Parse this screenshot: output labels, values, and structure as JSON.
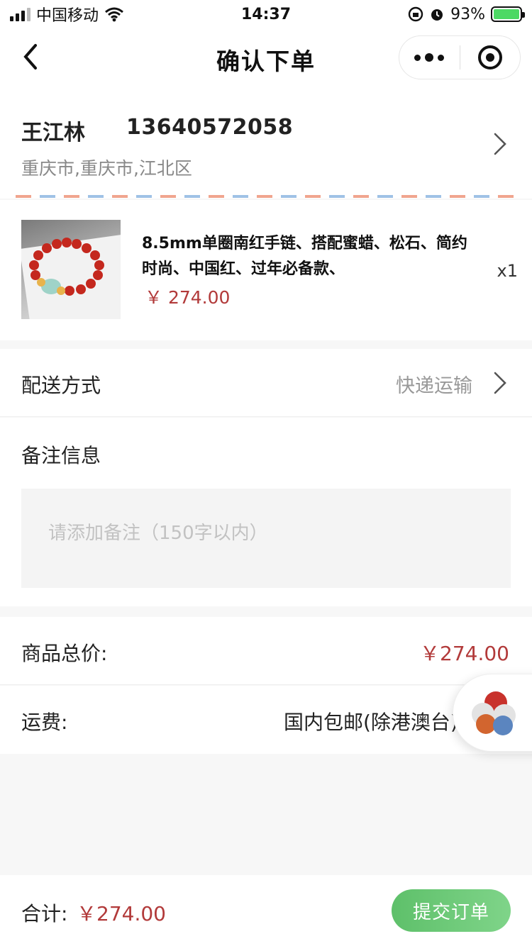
{
  "status_bar": {
    "carrier": "中国移动",
    "time": "14:37",
    "battery": "93%"
  },
  "nav": {
    "title": "确认下单"
  },
  "address": {
    "name": "王江林",
    "phone": "13640572058",
    "region": "重庆市,重庆市,江北区"
  },
  "product": {
    "title": "8.5mm单圈南红手链、搭配蜜蜡、松石、简约时尚、中国红、过年必备款、",
    "price": "￥ 274.00",
    "quantity": "x1"
  },
  "delivery": {
    "label": "配送方式",
    "value": "快递运输"
  },
  "remarks": {
    "label": "备注信息",
    "placeholder": "请添加备注（150字以内）"
  },
  "totals": {
    "goods_label": "商品总价:",
    "goods_value": "￥274.00",
    "shipping_label": "运费:",
    "shipping_value": "国内包邮(除港澳台)"
  },
  "footer": {
    "sum_label": "合计:",
    "sum_value": "￥274.00",
    "submit_label": "提交订单"
  },
  "colors": {
    "price_red": "#b23a3a",
    "submit_green": "#5ec06a"
  }
}
